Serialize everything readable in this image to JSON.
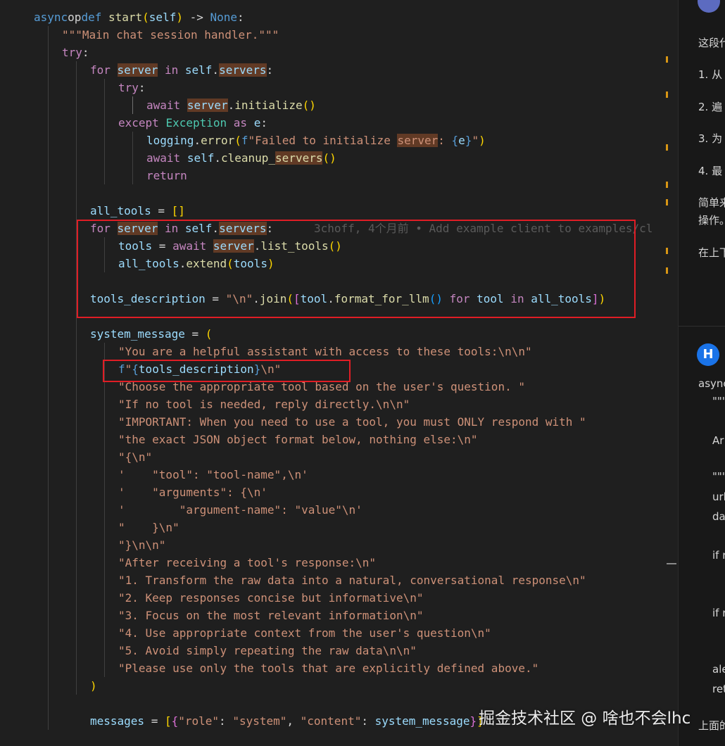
{
  "editor": {
    "lines": [
      {
        "id": "def-start",
        "tokens": [
          [
            "kw",
            "async"
          ],
          [
            " ",
            "op"
          ],
          [
            "kw",
            "def"
          ],
          [
            "op",
            " "
          ],
          [
            "fn",
            "start"
          ],
          [
            "br1",
            "("
          ],
          [
            "var",
            "self"
          ],
          [
            "br1",
            ")"
          ],
          [
            "op",
            " -> "
          ],
          [
            "kw",
            "None"
          ],
          [
            "op",
            ":"
          ]
        ]
      },
      {
        "id": "docstring",
        "tokens": [
          [
            "str",
            "\"\"\"Main chat session handler.\"\"\""
          ]
        ]
      },
      {
        "id": "try-outer",
        "tokens": [
          [
            "ctl",
            "try"
          ],
          [
            "op",
            ":"
          ]
        ]
      },
      {
        "id": "for-init",
        "tokens": [
          [
            "ctl",
            "for"
          ],
          [
            "op",
            " "
          ],
          [
            "hlvar",
            "server"
          ],
          [
            "op",
            " "
          ],
          [
            "ctl",
            "in"
          ],
          [
            "op",
            " "
          ],
          [
            "var",
            "self"
          ],
          [
            "op",
            "."
          ],
          [
            "hlvar",
            "servers"
          ],
          [
            "op",
            ":"
          ]
        ]
      },
      {
        "id": "try-inner",
        "tokens": [
          [
            "ctl",
            "try"
          ],
          [
            "op",
            ":"
          ]
        ]
      },
      {
        "id": "await-init",
        "tokens": [
          [
            "ctl",
            "await"
          ],
          [
            "op",
            " "
          ],
          [
            "hlvar",
            "server"
          ],
          [
            "op",
            "."
          ],
          [
            "fn",
            "initialize"
          ],
          [
            "br1",
            "()"
          ]
        ]
      },
      {
        "id": "except",
        "tokens": [
          [
            "ctl",
            "except"
          ],
          [
            "op",
            " "
          ],
          [
            "cls",
            "Exception"
          ],
          [
            "op",
            " "
          ],
          [
            "ctl",
            "as"
          ],
          [
            "op",
            " "
          ],
          [
            "var",
            "e"
          ],
          [
            "op",
            ":"
          ]
        ]
      },
      {
        "id": "logging-error",
        "tokens": [
          [
            "var",
            "logging"
          ],
          [
            "op",
            "."
          ],
          [
            "fn",
            "error"
          ],
          [
            "br1",
            "("
          ],
          [
            "kw",
            "f"
          ],
          [
            "str",
            "\"Failed to initialize "
          ],
          [
            "hlstr",
            "server"
          ],
          [
            "str",
            ": "
          ],
          [
            "kw",
            "{"
          ],
          [
            "var",
            "e"
          ],
          [
            "kw",
            "}"
          ],
          [
            "str",
            "\""
          ],
          [
            "br1",
            ")"
          ]
        ]
      },
      {
        "id": "await-cleanup",
        "tokens": [
          [
            "ctl",
            "await"
          ],
          [
            "op",
            " "
          ],
          [
            "var",
            "self"
          ],
          [
            "op",
            "."
          ],
          [
            "fn",
            "cleanup_"
          ],
          [
            "hlfn",
            "servers"
          ],
          [
            "br1",
            "()"
          ]
        ]
      },
      {
        "id": "return",
        "tokens": [
          [
            "ctl",
            "return"
          ]
        ]
      },
      {
        "id": "blank-1",
        "tokens": []
      },
      {
        "id": "all-tools",
        "tokens": [
          [
            "var",
            "all_tools"
          ],
          [
            "op",
            " = "
          ],
          [
            "br1",
            "[]"
          ]
        ]
      },
      {
        "id": "for-list",
        "tokens": [
          [
            "ctl",
            "for"
          ],
          [
            "op",
            " "
          ],
          [
            "hlvar",
            "server"
          ],
          [
            "op",
            " "
          ],
          [
            "ctl",
            "in"
          ],
          [
            "op",
            " "
          ],
          [
            "var",
            "self"
          ],
          [
            "op",
            "."
          ],
          [
            "hlvar",
            "servers"
          ],
          [
            "op",
            ":"
          ],
          [
            "op",
            "      "
          ],
          [
            "blame",
            "3choff, 4个月前 • Add example client to examples/cl"
          ]
        ]
      },
      {
        "id": "tools-assign",
        "tokens": [
          [
            "var",
            "tools"
          ],
          [
            "op",
            " = "
          ],
          [
            "ctl",
            "await"
          ],
          [
            "op",
            " "
          ],
          [
            "hlvar",
            "server"
          ],
          [
            "op",
            "."
          ],
          [
            "fn",
            "list_tools"
          ],
          [
            "br1",
            "()"
          ]
        ]
      },
      {
        "id": "extend",
        "tokens": [
          [
            "var",
            "all_tools"
          ],
          [
            "op",
            "."
          ],
          [
            "fn",
            "extend"
          ],
          [
            "br1",
            "("
          ],
          [
            "var",
            "tools"
          ],
          [
            "br1",
            ")"
          ]
        ]
      },
      {
        "id": "blank-2",
        "tokens": []
      },
      {
        "id": "tools-desc",
        "tokens": [
          [
            "var",
            "tools_description"
          ],
          [
            "op",
            " = "
          ],
          [
            "str",
            "\"\\n\""
          ],
          [
            "op",
            "."
          ],
          [
            "fn",
            "join"
          ],
          [
            "br1",
            "("
          ],
          [
            "br2",
            "["
          ],
          [
            "var",
            "tool"
          ],
          [
            "op",
            "."
          ],
          [
            "fn",
            "format_for_llm"
          ],
          [
            "br3",
            "()"
          ],
          [
            "op",
            " "
          ],
          [
            "ctl",
            "for"
          ],
          [
            "op",
            " "
          ],
          [
            "var",
            "tool"
          ],
          [
            "op",
            " "
          ],
          [
            "ctl",
            "in"
          ],
          [
            "op",
            " "
          ],
          [
            "var",
            "all_tools"
          ],
          [
            "br2",
            "]"
          ],
          [
            "br1",
            ")"
          ]
        ]
      },
      {
        "id": "blank-3",
        "tokens": []
      },
      {
        "id": "sys-msg",
        "tokens": [
          [
            "var",
            "system_message"
          ],
          [
            "op",
            " = "
          ],
          [
            "br1",
            "("
          ]
        ]
      },
      {
        "id": "str-1",
        "tokens": [
          [
            "str",
            "\"You are a helpful assistant with access to these tools:\\n\\n\""
          ]
        ]
      },
      {
        "id": "str-2",
        "tokens": [
          [
            "kw",
            "f"
          ],
          [
            "str",
            "\""
          ],
          [
            "kw",
            "{"
          ],
          [
            "var",
            "tools_description"
          ],
          [
            "kw",
            "}"
          ],
          [
            "str",
            "\\n\""
          ]
        ]
      },
      {
        "id": "str-3",
        "tokens": [
          [
            "str",
            "\"Choose the appropriate tool based on the user's question. \""
          ]
        ]
      },
      {
        "id": "str-4",
        "tokens": [
          [
            "str",
            "\"If no tool is needed, reply directly.\\n\\n\""
          ]
        ]
      },
      {
        "id": "str-5",
        "tokens": [
          [
            "str",
            "\"IMPORTANT: When you need to use a tool, you must ONLY respond with \""
          ]
        ]
      },
      {
        "id": "str-6",
        "tokens": [
          [
            "str",
            "\"the exact JSON object format below, nothing else:\\n\""
          ]
        ]
      },
      {
        "id": "str-7",
        "tokens": [
          [
            "str",
            "\"{\\n\""
          ]
        ]
      },
      {
        "id": "str-8",
        "tokens": [
          [
            "str",
            "'    \"tool\": \"tool-name\",\\n'"
          ]
        ]
      },
      {
        "id": "str-9",
        "tokens": [
          [
            "str",
            "'    \"arguments\": {\\n'"
          ]
        ]
      },
      {
        "id": "str-10",
        "tokens": [
          [
            "str",
            "'        \"argument-name\": \"value\"\\n'"
          ]
        ]
      },
      {
        "id": "str-11",
        "tokens": [
          [
            "str",
            "\"    }\\n\""
          ]
        ]
      },
      {
        "id": "str-12",
        "tokens": [
          [
            "str",
            "\"}\\n\\n\""
          ]
        ]
      },
      {
        "id": "str-13",
        "tokens": [
          [
            "str",
            "\"After receiving a tool's response:\\n\""
          ]
        ]
      },
      {
        "id": "str-14",
        "tokens": [
          [
            "str",
            "\"1. Transform the raw data into a natural, conversational response\\n\""
          ]
        ]
      },
      {
        "id": "str-15",
        "tokens": [
          [
            "str",
            "\"2. Keep responses concise but informative\\n\""
          ]
        ]
      },
      {
        "id": "str-16",
        "tokens": [
          [
            "str",
            "\"3. Focus on the most relevant information\\n\""
          ]
        ]
      },
      {
        "id": "str-17",
        "tokens": [
          [
            "str",
            "\"4. Use appropriate context from the user's question\\n\""
          ]
        ]
      },
      {
        "id": "str-18",
        "tokens": [
          [
            "str",
            "\"5. Avoid simply repeating the raw data\\n\\n\""
          ]
        ]
      },
      {
        "id": "str-19",
        "tokens": [
          [
            "str",
            "\"Please use only the tools that are explicitly defined above.\""
          ]
        ]
      },
      {
        "id": "close-paren",
        "tokens": [
          [
            "br1",
            ")"
          ]
        ]
      },
      {
        "id": "blank-4",
        "tokens": []
      },
      {
        "id": "messages",
        "tokens": [
          [
            "var",
            "messages"
          ],
          [
            "op",
            " = "
          ],
          [
            "br1",
            "["
          ],
          [
            "br2",
            "{"
          ],
          [
            "str",
            "\"role\""
          ],
          [
            "op",
            ": "
          ],
          [
            "str",
            "\"system\""
          ],
          [
            "op",
            ", "
          ],
          [
            "str",
            "\"content\""
          ],
          [
            "op",
            ": "
          ],
          [
            "var",
            "system_message"
          ],
          [
            "br2",
            "}"
          ],
          [
            "br1",
            "]"
          ]
        ]
      }
    ]
  },
  "chat": {
    "assistant_lines": [
      "这段代",
      "1. 从",
      "2. 遍",
      "3. 为",
      "4. 最",
      "简单来",
      "操作。",
      "在上下"
    ],
    "user_avatar_letter": "H",
    "user_code_lines": [
      "async",
      "\"\"\"",
      "Ar",
      "\"\"\"",
      "url",
      "da",
      "if r",
      "if r",
      "ale",
      "ret",
      "上面的"
    ]
  },
  "watermark": "掘金技术社区 @ 啥也不会lhc",
  "colors": {
    "highlight_box": "#e01d25",
    "selection_highlight": "#613a25",
    "user_avatar": "#1a73e8"
  }
}
